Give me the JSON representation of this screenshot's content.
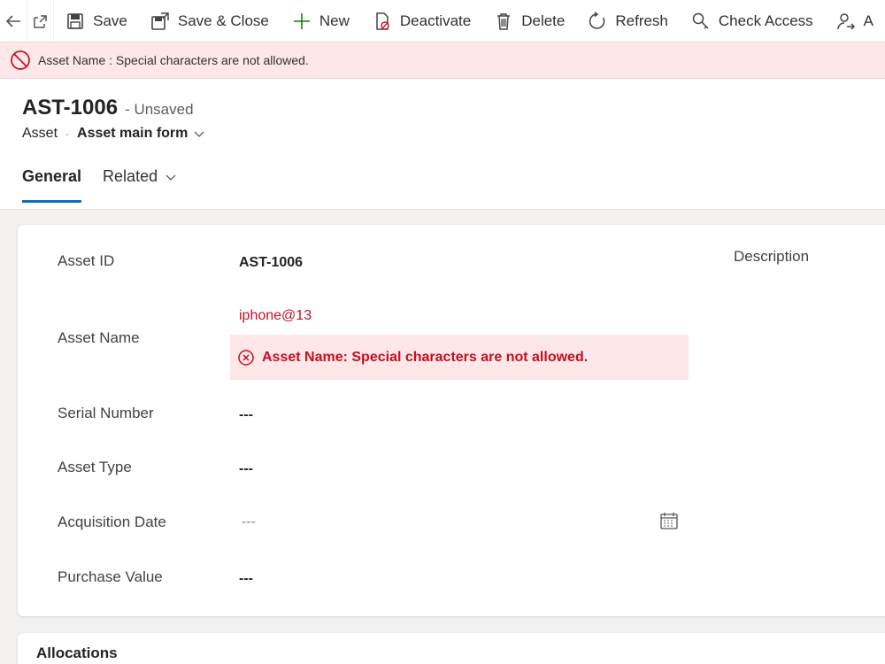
{
  "toolbar": {
    "save": "Save",
    "save_close": "Save & Close",
    "new": "New",
    "deactivate": "Deactivate",
    "delete": "Delete",
    "refresh": "Refresh",
    "check_access": "Check Access",
    "truncated": "A"
  },
  "notification": {
    "text": "Asset Name : Special characters are not allowed.",
    "color": "#fde7e9"
  },
  "header": {
    "title": "AST-1006",
    "status": "- Unsaved",
    "entity": "Asset",
    "separator": "·",
    "form": "Asset main form"
  },
  "tabs": [
    {
      "label": "General",
      "active": true
    },
    {
      "label": "Related",
      "active": false
    }
  ],
  "form": {
    "asset_id": {
      "label": "Asset ID",
      "value": "AST-1006"
    },
    "asset_name": {
      "label": "Asset Name",
      "value": "iphone@13",
      "error": "Asset Name: Special characters are not allowed."
    },
    "serial_number": {
      "label": "Serial Number",
      "value": "---"
    },
    "asset_type": {
      "label": "Asset Type",
      "value": "---"
    },
    "acquisition_date": {
      "label": "Acquisition Date",
      "value": "---"
    },
    "purchase_value": {
      "label": "Purchase Value",
      "value": "---"
    },
    "description": {
      "label": "Description"
    }
  },
  "allocations": {
    "title": "Allocations"
  },
  "colors": {
    "accent": "#0f6cbd",
    "error": "#c50f1f",
    "new_icon": "#107c10"
  }
}
